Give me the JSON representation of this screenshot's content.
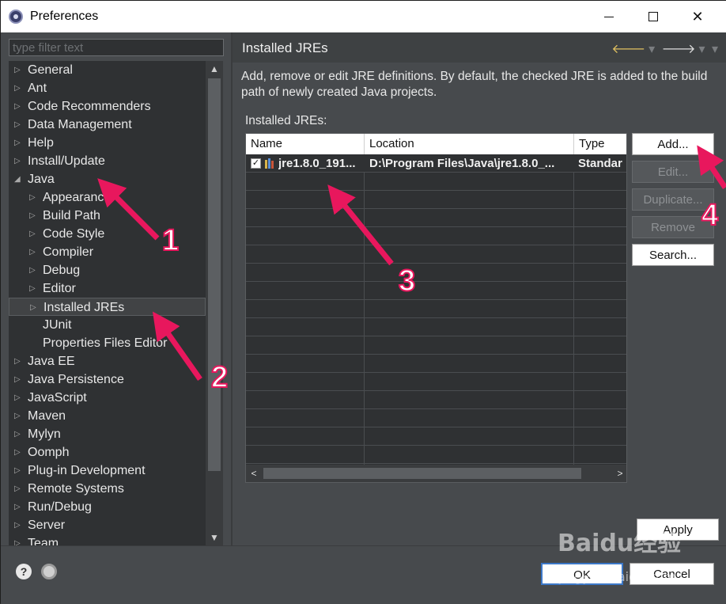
{
  "window": {
    "title": "Preferences"
  },
  "filter": {
    "placeholder": "type filter text"
  },
  "tree": [
    {
      "label": "General",
      "level": 0,
      "twisty": "collapsed"
    },
    {
      "label": "Ant",
      "level": 0,
      "twisty": "collapsed"
    },
    {
      "label": "Code Recommenders",
      "level": 0,
      "twisty": "collapsed"
    },
    {
      "label": "Data Management",
      "level": 0,
      "twisty": "collapsed"
    },
    {
      "label": "Help",
      "level": 0,
      "twisty": "collapsed"
    },
    {
      "label": "Install/Update",
      "level": 0,
      "twisty": "collapsed"
    },
    {
      "label": "Java",
      "level": 0,
      "twisty": "expanded"
    },
    {
      "label": "Appearance",
      "level": 1,
      "twisty": "collapsed"
    },
    {
      "label": "Build Path",
      "level": 1,
      "twisty": "collapsed"
    },
    {
      "label": "Code Style",
      "level": 1,
      "twisty": "collapsed"
    },
    {
      "label": "Compiler",
      "level": 1,
      "twisty": "collapsed"
    },
    {
      "label": "Debug",
      "level": 1,
      "twisty": "collapsed"
    },
    {
      "label": "Editor",
      "level": 1,
      "twisty": "collapsed"
    },
    {
      "label": "Installed JREs",
      "level": 1,
      "twisty": "collapsed",
      "selected": true
    },
    {
      "label": "JUnit",
      "level": 1,
      "twisty": "none"
    },
    {
      "label": "Properties Files Editor",
      "level": 1,
      "twisty": "none"
    },
    {
      "label": "Java EE",
      "level": 0,
      "twisty": "collapsed"
    },
    {
      "label": "Java Persistence",
      "level": 0,
      "twisty": "collapsed"
    },
    {
      "label": "JavaScript",
      "level": 0,
      "twisty": "collapsed"
    },
    {
      "label": "Maven",
      "level": 0,
      "twisty": "collapsed"
    },
    {
      "label": "Mylyn",
      "level": 0,
      "twisty": "collapsed"
    },
    {
      "label": "Oomph",
      "level": 0,
      "twisty": "collapsed"
    },
    {
      "label": "Plug-in Development",
      "level": 0,
      "twisty": "collapsed"
    },
    {
      "label": "Remote Systems",
      "level": 0,
      "twisty": "collapsed"
    },
    {
      "label": "Run/Debug",
      "level": 0,
      "twisty": "collapsed"
    },
    {
      "label": "Server",
      "level": 0,
      "twisty": "collapsed"
    },
    {
      "label": "Team",
      "level": 0,
      "twisty": "collapsed"
    }
  ],
  "page": {
    "title": "Installed JREs",
    "description": "Add, remove or edit JRE definitions. By default, the checked JRE is added to the build path of newly created Java projects.",
    "table_label": "Installed JREs:",
    "columns": [
      "Name",
      "Location",
      "Type"
    ],
    "rows": [
      {
        "name": "jre1.8.0_191...",
        "location": "D:\\Program Files\\Java\\jre1.8.0_...",
        "type": "Standar",
        "checked": true
      }
    ],
    "buttons": {
      "add": "Add...",
      "edit": "Edit...",
      "duplicate": "Duplicate...",
      "remove": "Remove",
      "search": "Search..."
    },
    "apply": "Apply"
  },
  "footer": {
    "ok": "OK",
    "cancel": "Cancel"
  },
  "annotations": [
    "1",
    "2",
    "3",
    "4"
  ],
  "watermark": {
    "brand": "Baidu经验",
    "url": "jingyan.baidu.com"
  },
  "colors": {
    "annotation": "#e8175d",
    "selection": "#414345",
    "focus": "#3c78c8"
  }
}
